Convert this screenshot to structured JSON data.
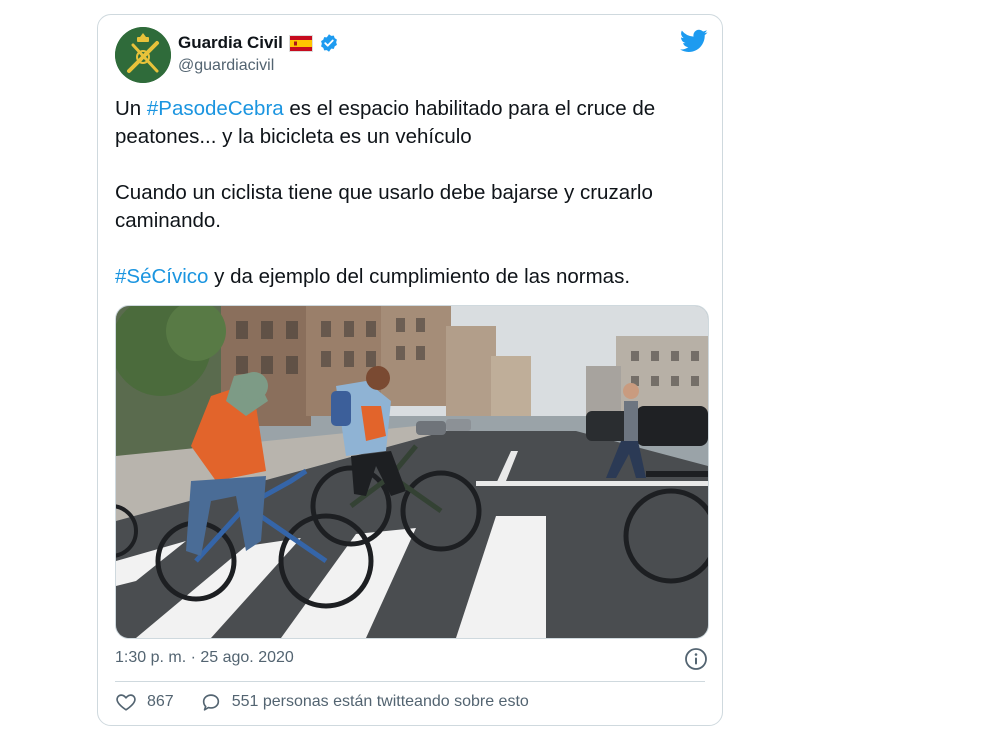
{
  "tweet": {
    "display_name": "Guardia Civil",
    "handle": "@guardiacivil",
    "paragraph_1": {
      "prefix": "Un ",
      "hashtag": "#PasodeCebra",
      "suffix": " es el espacio habilitado para el cruce de peatones... y la bicicleta es un vehículo"
    },
    "paragraph_2": "Cuando un ciclista tiene que usarlo debe bajarse y cruzarlo caminando.",
    "paragraph_3": {
      "hashtag": "#SéCívico",
      "suffix": " y da ejemplo del cumplimiento de las normas."
    },
    "timestamp": "1:30 p. m. · 25 ago. 2020",
    "likes": "867",
    "talking": "551 personas están twitteando sobre esto"
  },
  "colors": {
    "hashtag": "#1b95e0",
    "verified": "#1d9bf0",
    "twitter_bird": "#1d9bf0",
    "avatar_bg": "#2f6b3a"
  },
  "icons": {
    "brand": "twitter-bird-icon",
    "verified": "verified-badge-icon",
    "flag": "spain-flag-icon",
    "info": "info-icon",
    "like": "heart-icon",
    "reply": "speech-bubble-icon"
  }
}
